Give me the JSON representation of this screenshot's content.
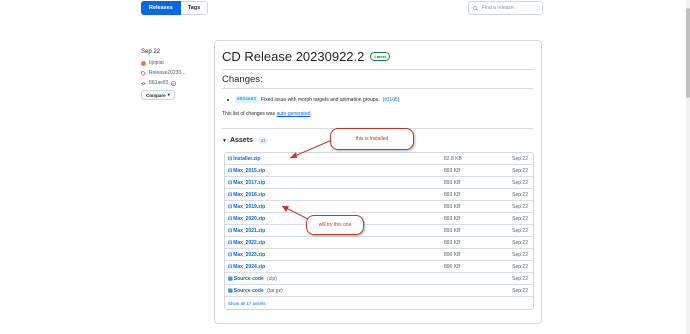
{
  "nav": {
    "releases_label": "Releases",
    "tags_label": "Tags"
  },
  "search": {
    "placeholder": "Find a release"
  },
  "sidebar": {
    "date": "Sep 22",
    "author": "bjoplat",
    "tag": "Release20230...",
    "commit": "863ae83",
    "compare_label": "Compare"
  },
  "release": {
    "title": "CD Release 20230922.2",
    "badge": "Latest",
    "changes_heading": "Changes:",
    "change_sha": "863ae83",
    "change_text": "Fixed issue with morph targets and animation groups.",
    "change_ref": "(#1105)",
    "note_prefix": "This list of changes was ",
    "note_link": "auto-generated",
    "note_suffix": "."
  },
  "assets": {
    "heading": "Assets",
    "count": "17",
    "items": [
      {
        "name": "Installer.zip",
        "size": "82.8 KB",
        "date": "Sep 22"
      },
      {
        "name": "Max_2015.zip",
        "size": "893 KB",
        "date": "Sep 22"
      },
      {
        "name": "Max_2017.zip",
        "size": "893 KB",
        "date": "Sep 22"
      },
      {
        "name": "Max_2018.zip",
        "size": "893 KB",
        "date": "Sep 22"
      },
      {
        "name": "Max_2019.zip",
        "size": "893 KB",
        "date": "Sep 22"
      },
      {
        "name": "Max_2020.zip",
        "size": "893 KB",
        "date": "Sep 22"
      },
      {
        "name": "Max_2021.zip",
        "size": "893 KB",
        "date": "Sep 22"
      },
      {
        "name": "Max_2022.zip",
        "size": "893 KB",
        "date": "Sep 22"
      },
      {
        "name": "Max_2023.zip",
        "size": "896 KB",
        "date": "Sep 22"
      },
      {
        "name": "Max_2024.zip",
        "size": "896 KB",
        "date": "Sep 22"
      }
    ],
    "source_zip": {
      "name": "Source code",
      "ext": "(zip)",
      "date": "Sep 22"
    },
    "source_tar": {
      "name": "Source code",
      "ext": "(tar.gz)",
      "date": "Sep 22"
    },
    "show_all": "Show all 17 assets"
  },
  "annotations": {
    "installed": "this is installed",
    "try": "will try this one"
  },
  "colors": {
    "accent": "#0969da",
    "annotation": "#c0392b",
    "success": "#1a7f37"
  }
}
